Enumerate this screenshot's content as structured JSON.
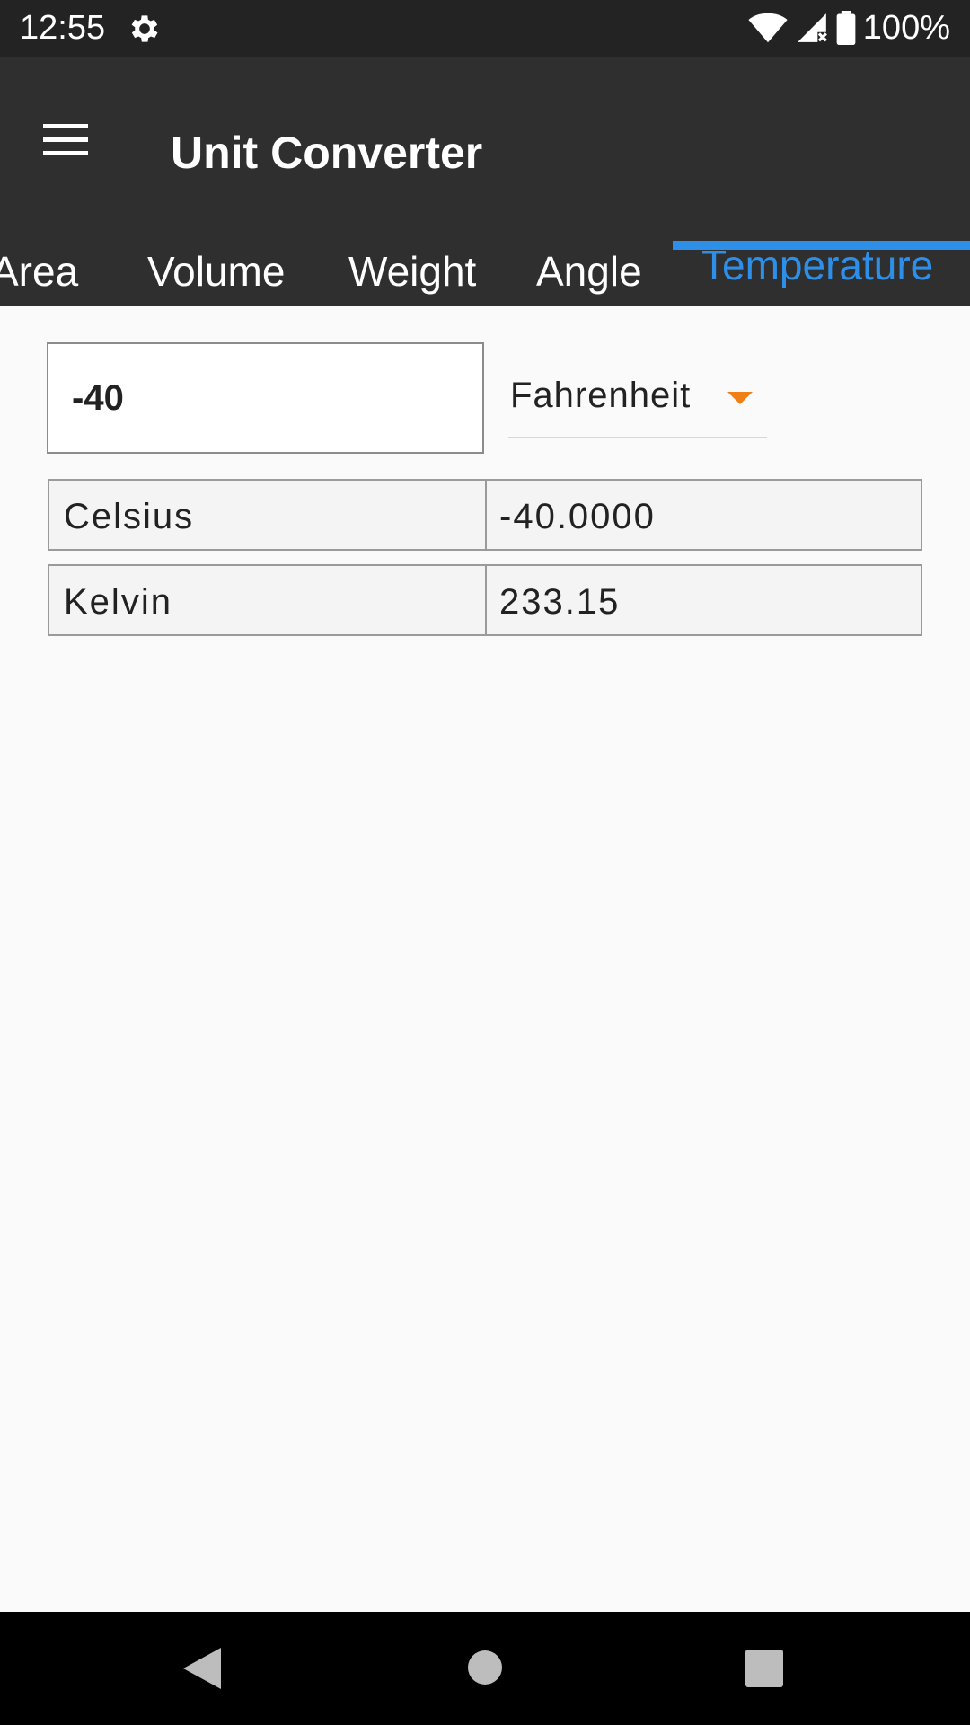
{
  "status_bar": {
    "time": "12:55",
    "battery_text": "100%",
    "icons": [
      "gear-icon",
      "wifi-icon",
      "signal-icon",
      "battery-icon"
    ]
  },
  "app_bar": {
    "title": "Unit Converter",
    "menu_icon": "menu-icon"
  },
  "tabs": [
    {
      "label": "Area",
      "active": false
    },
    {
      "label": "Volume",
      "active": false
    },
    {
      "label": "Weight",
      "active": false
    },
    {
      "label": "Angle",
      "active": false
    },
    {
      "label": "Temperature",
      "active": true
    }
  ],
  "converter": {
    "input_value": "-40",
    "selected_unit": "Fahrenheit",
    "results": [
      {
        "unit": "Celsius",
        "value": "-40.0000"
      },
      {
        "unit": "Kelvin",
        "value": "233.15"
      }
    ]
  },
  "colors": {
    "accent": "#2d8fe8",
    "dropdown_caret": "#f07f16",
    "toolbar": "#2f2f2f",
    "status_bar": "#232323"
  },
  "nav_bar": {
    "icons": [
      "back-icon",
      "home-icon",
      "recents-icon"
    ]
  }
}
